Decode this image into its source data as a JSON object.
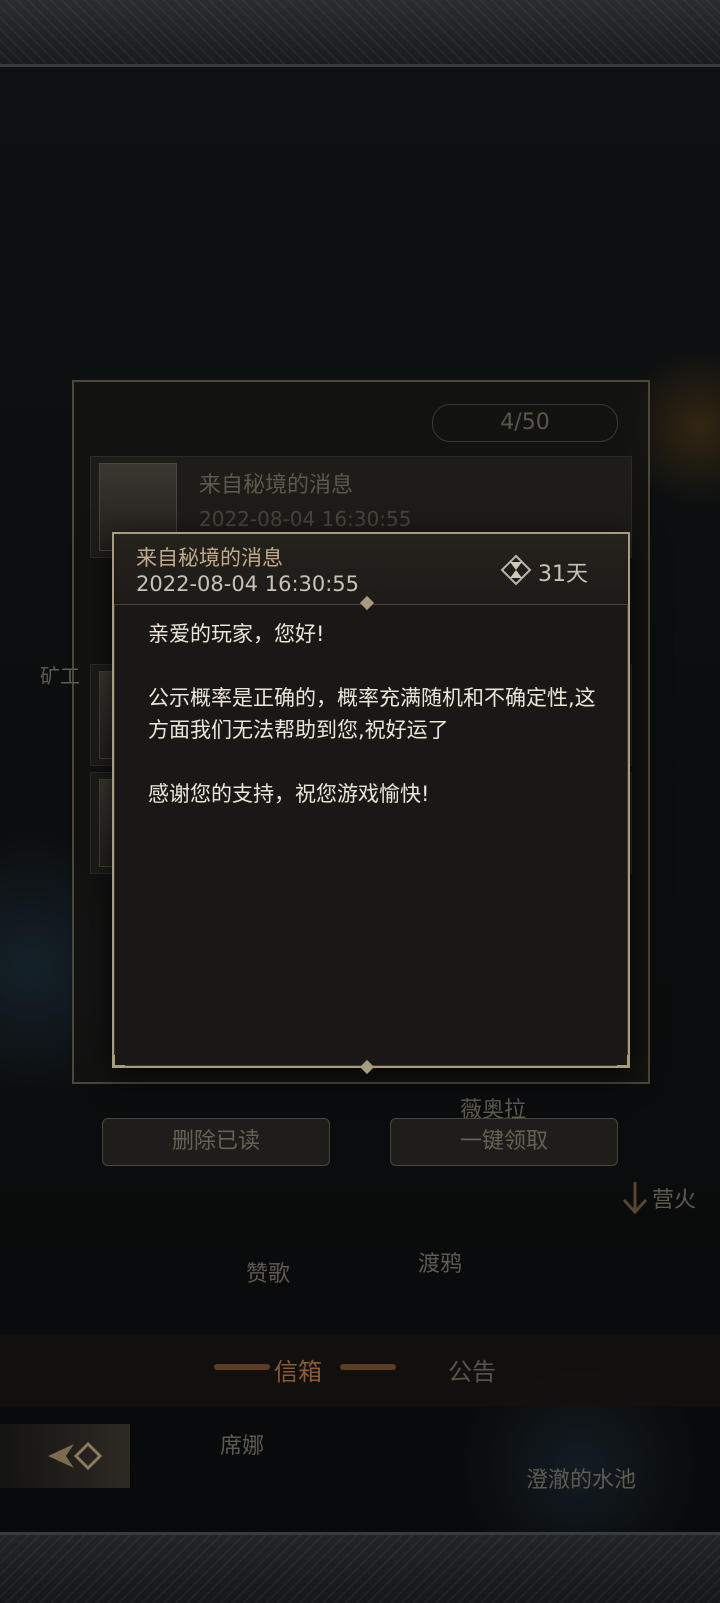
{
  "background": {
    "mail_count": "4/50",
    "mail_row_title": "来自秘境的消息",
    "mail_row_date": "2022-08-04 16:30:55",
    "mail_row_expiry": "31天",
    "side_label": "矿工",
    "name_weiaola": "薇奥拉",
    "btn_delete_read": "删除已读",
    "btn_claim_all": "一键领取",
    "campfire": "营火",
    "zange": "赞歌",
    "duya": "渡鸦",
    "xina": "席娜",
    "pool": "澄澈的水池"
  },
  "tabs": {
    "mailbox": "信箱",
    "notice": "公告"
  },
  "letter": {
    "title": "来自秘境的消息",
    "date": "2022-08-04 16:30:55",
    "expiry": "31天",
    "greeting": "亲爱的玩家，您好!",
    "paragraph1": "公示概率是正确的，概率充满随机和不确定性,这方面我们无法帮助到您,祝好运了",
    "paragraph2": "感谢您的支持，祝您游戏愉快!"
  },
  "colors": {
    "accent_gold": "#a99b7e",
    "tab_active": "#8a5c36"
  },
  "icons": {
    "expiry": "hourglass-icon",
    "back": "back-arrow-icon",
    "campfire": "down-arrow-icon"
  }
}
